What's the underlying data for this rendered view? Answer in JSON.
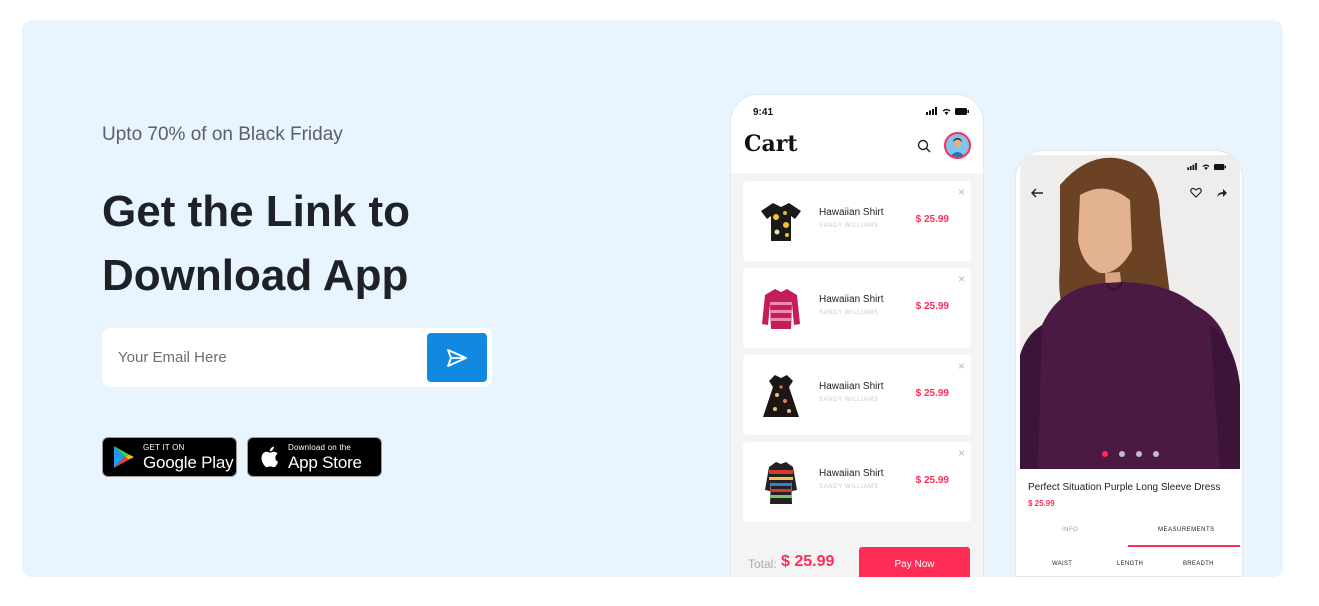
{
  "promo": {
    "eyebrow": "Upto 70% of on Black Friday",
    "headline": "Get the Link to Download App"
  },
  "email_form": {
    "placeholder": "Your Email Here",
    "send_icon": "send-icon"
  },
  "store_buttons": {
    "google_play": {
      "small": "GET IT ON",
      "big": "Google Play"
    },
    "app_store": {
      "small": "Download on the",
      "big": "App Store"
    }
  },
  "cart_phone": {
    "time": "9:41",
    "title": "Cart",
    "items": [
      {
        "name": "Hawaiian Shirt",
        "sub": "SANDY WILLIAMS",
        "price": "$ 25.99",
        "close": "×"
      },
      {
        "name": "Hawaiian Shirt",
        "sub": "SANDY WILLIAMS",
        "price": "$ 25.99",
        "close": "×"
      },
      {
        "name": "Hawaiian Shirt",
        "sub": "SANDY WILLIAMS",
        "price": "$ 25.99",
        "close": "×"
      },
      {
        "name": "Hawaiian Shirt",
        "sub": "SANDY WILLIAMS",
        "price": "$ 25.99",
        "close": "×"
      }
    ],
    "total_label": "Total:",
    "total_value": "$ 25.99",
    "pay_label": "Pay Now"
  },
  "product_phone": {
    "product_name": "Perfect Situation Purple Long Sleeve Dress",
    "price": "$ 25.99",
    "tabs": [
      "INFO",
      "MEASUREMENTS"
    ],
    "columns": [
      "WAIST",
      "LENGTH",
      "BREADTH"
    ]
  },
  "colors": {
    "banner_bg": "#e8f4fe",
    "accent_blue": "#1189e0",
    "accent_pink": "#ff2d55",
    "dress_purple": "#4a1a45"
  }
}
